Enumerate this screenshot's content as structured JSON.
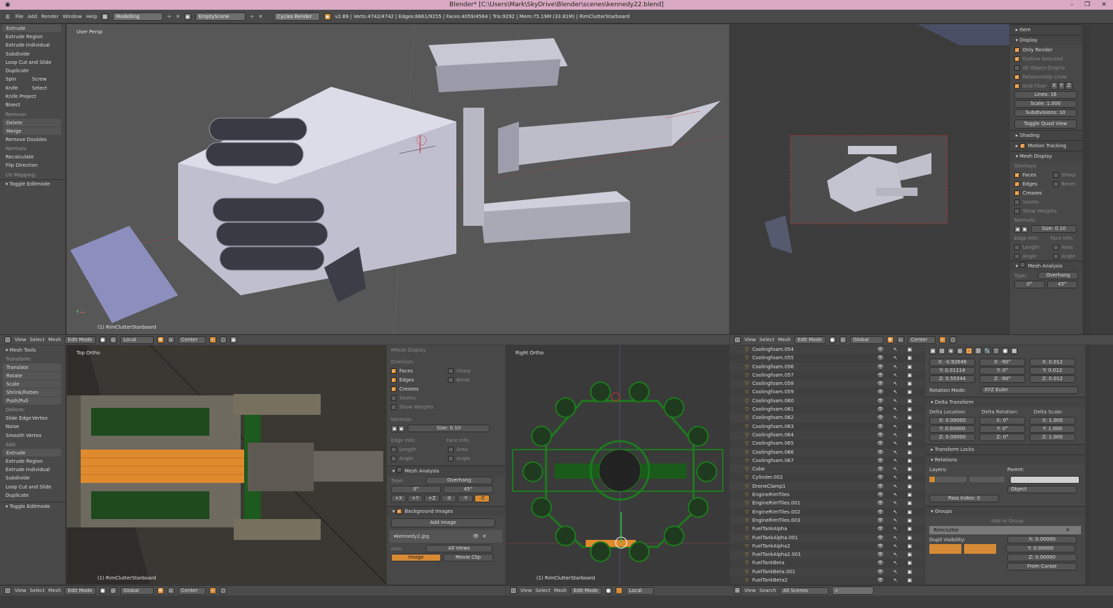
{
  "title": "Blender* [C:\\Users\\Mark\\SkyDrive\\Blender\\scenes\\kennedy22.blend]",
  "colors": {
    "titlebar": "#d9a9c2",
    "accent": "#d68a35",
    "viewport": "#575757",
    "orange_sel": "#e08a2e",
    "wire_green": "#1e7a1e"
  },
  "menu": {
    "items": [
      "File",
      "Add",
      "Render",
      "Window",
      "Help"
    ],
    "layout": "Modelling",
    "scene": "EmptyScene",
    "engine": "Cycles Render",
    "stats": "v2.69 | Verts:4742/4742 | Edges:8661/9255 | Faces:4059/4564 | Tris:9292 | Mem:75.19M (33.81M) | RimClutterStarboard"
  },
  "tl_tools": {
    "items": [
      "Extrude",
      "Extrude Region",
      "Extrude Individual",
      "Subdivide",
      "Loop Cut and Slide",
      "Duplicate",
      "Spin",
      "Screw",
      "Knife",
      "Select",
      "Knife Project",
      "Bisect"
    ],
    "remove_label": "Remove:",
    "remove": [
      "Delete",
      "Merge",
      "Remove Doubles"
    ],
    "normals_label": "Normals:",
    "normals": [
      "Recalculate",
      "Flip Direction"
    ],
    "uv": "UV Mapping:",
    "toggle": "Toggle Editmode"
  },
  "vp_persp": {
    "label": "User Persp",
    "object": "(1) RimClutterStarboard"
  },
  "vp_camera": {
    "panels": {
      "item": "Item",
      "display": "Display",
      "only_render": "Only Render",
      "outline": "Outline Selected",
      "all_origins": "All Object Origins",
      "rel_lines": "Relationship Lines",
      "grid_floor": "Grid Floor",
      "grid_axes": [
        "X",
        "Y",
        "Z"
      ],
      "lines": "Lines: 16",
      "scale": "Scale: 1.000",
      "subdiv": "Subdivisions: 10",
      "quad": "Toggle Quad View",
      "shading": "Shading",
      "motion": "Motion Tracking",
      "mesh_display": "Mesh Display",
      "overlays": "Overlays:",
      "faces": "Faces",
      "sharp": "Sharp",
      "edges": "Edges",
      "bevel": "Bevel",
      "creases": "Creases",
      "seams": "Seams",
      "weights": "Show Weights",
      "normals": "Normals:",
      "size": "Size: 0.10",
      "edge_info": "Edge Info:",
      "face_info": "Face Info:",
      "length": "Length",
      "area": "Area",
      "angle": "Angle",
      "angle2": "Angle",
      "analysis": "Mesh Analysis",
      "type": "Type:",
      "overhang": "Overhang",
      "deg0": "0°",
      "deg45": "45°"
    }
  },
  "hdr_top": {
    "items": [
      "View",
      "Select",
      "Mesh"
    ],
    "mode": "Edit Mode",
    "orient": "Local",
    "pivot": "Center",
    "mode2": "Edit Mode",
    "orient2": "Global",
    "pivot2": "Center",
    "items2": [
      "View",
      "Select",
      "Mesh"
    ]
  },
  "bl_tools": {
    "title": "Mesh Tools",
    "transform": "Transform:",
    "t_items": [
      "Translate",
      "Rotate",
      "Scale",
      "Shrink/Fatten",
      "Push/Pull"
    ],
    "deform": "Deform:",
    "slide": "Slide Edge",
    "vertex": "Vertex",
    "noise": "Noise",
    "smooth": "Smooth Vertex",
    "add": "Add:",
    "add_items": [
      "Extrude",
      "Extrude Region",
      "Extrude Individual",
      "Subdivide",
      "Loop Cut and Slide",
      "Duplicate"
    ],
    "toggle": "Toggle Editmode"
  },
  "vp_top": {
    "label": "Top Ortho",
    "object": "(1) RimClutterStarboard"
  },
  "mid_props": {
    "mesh_display": "Mesh Display",
    "overlays": "Overlays:",
    "faces": "Faces",
    "sharp": "Sharp",
    "edges": "Edges",
    "bevel": "Bevel",
    "creases": "Creases",
    "seams": "Seams",
    "weights": "Show Weights",
    "normals": "Normals:",
    "size": "Size: 0.10",
    "edge_info": "Edge Info:",
    "face_info": "Face Info:",
    "length": "Length",
    "area": "Area",
    "angle": "Angle",
    "angle2": "Angle",
    "analysis": "Mesh Analysis",
    "type": "Type:",
    "overhang": "Overhang",
    "deg0": "0°",
    "deg45": "45°",
    "axes": [
      "+X",
      "+Y",
      "+Z",
      "-X",
      "-Y",
      "-Z"
    ],
    "bg": "Background Images",
    "add_image": "Add Image",
    "file": "kennedy2.jpg",
    "axis": "Axis:",
    "all_views": "All Views",
    "image": "Image",
    "movie": "Movie Clip"
  },
  "vp_right": {
    "label": "Right Ortho",
    "object": "(1) RimClutterStarboard"
  },
  "outliner": {
    "rows": [
      "Coolingfoam.054",
      "Coolingfoam.055",
      "Coolingfoam.056",
      "Coolingfoam.057",
      "Coolingfoam.058",
      "Coolingfoam.059",
      "Coolingfoam.060",
      "Coolingfoam.061",
      "Coolingfoam.062",
      "Coolingfoam.063",
      "Coolingfoam.064",
      "Coolingfoam.065",
      "Coolingfoam.066",
      "Coolingfoam.067",
      "Cube",
      "Cylinder.002",
      "DroneClamp1",
      "EngineRimTiles",
      "EngineRimTiles.001",
      "EngineRimTiles.002",
      "EngineRimTiles.003",
      "FuelTankAlpha",
      "FuelTankAlpha.001",
      "FuelTankAlpha2",
      "FuelTankAlpha2.001",
      "FuelTankBeta",
      "FuelTankBeta.001",
      "FuelTankBeta2"
    ],
    "footer": [
      "View",
      "Search"
    ],
    "scenes": "All Scenes"
  },
  "obj_props": {
    "loc": [
      "X: -0.92646",
      "Y: 0.01114",
      "Z: 0.55344"
    ],
    "rot": [
      "X: -90°",
      "Y: 0°",
      "Z: -90°"
    ],
    "scale": [
      "X: 0.012",
      "Y: 0.012",
      "Z: 0.012"
    ],
    "rot_mode_label": "Rotation Mode:",
    "rot_mode": "XYZ Euler",
    "delta": "Delta Transform",
    "dl": "Delta Location:",
    "dr": "Delta Rotation:",
    "ds": "Delta Scale:",
    "dloc": [
      "X: 0.00000",
      "Y: 0.00000",
      "Z: 0.00000"
    ],
    "drot": [
      "X: 0°",
      "Y: 0°",
      "Z: 0°"
    ],
    "dscale": [
      "X: 1.000",
      "Y: 1.000",
      "Z: 1.000"
    ],
    "locks": "Transform Locks",
    "relations": "Relations",
    "layers": "Layers:",
    "parent": "Parent:",
    "object": "Object",
    "pass": "Pass Index: 0",
    "groups": "Groups",
    "add_group": "Add to Group",
    "group_name": "Rimclutter",
    "dupli": "Dupli Visibility:",
    "dx": [
      "X: 0.00000",
      "Y: 0.00000",
      "Z: 0.00000"
    ],
    "from_cursor": "From Cursor"
  },
  "hdr_bottom": {
    "items": [
      "View",
      "Select",
      "Mesh"
    ],
    "mode": "Edit Mode",
    "orient": "Global",
    "pivot": "Center",
    "items2": [
      "View",
      "Select",
      "Mesh"
    ],
    "mode2": "Edit Mode",
    "orient2": "Local"
  }
}
